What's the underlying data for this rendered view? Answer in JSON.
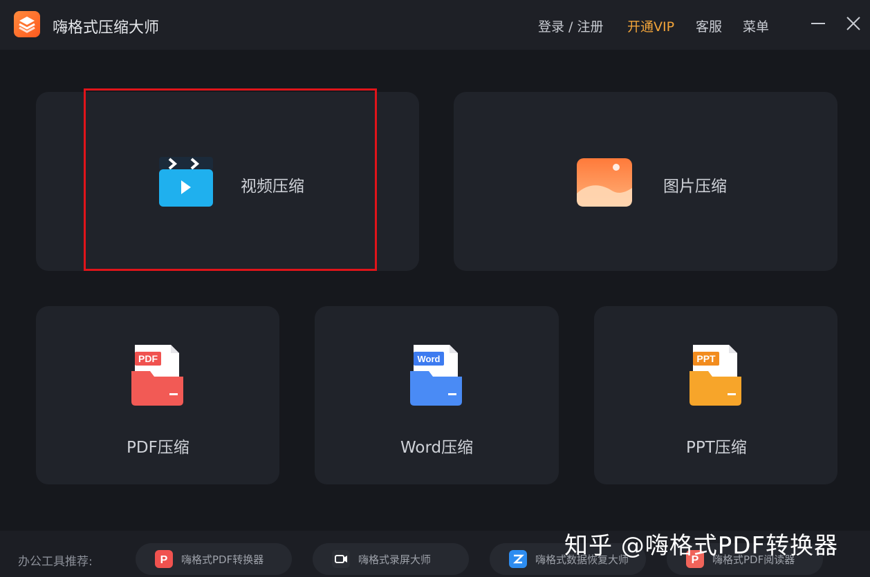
{
  "app": {
    "title": "嗨格式压缩大师"
  },
  "topnav": {
    "login": "登录 / 注册",
    "vip": "开通VIP",
    "service": "客服",
    "menu": "菜单"
  },
  "cards": {
    "video": "视频压缩",
    "image": "图片压缩",
    "pdf": "PDF压缩",
    "word": "Word压缩",
    "ppt": "PPT压缩"
  },
  "file_tags": {
    "pdf": "PDF",
    "word": "Word",
    "ppt": "PPT"
  },
  "footer": {
    "label": "办公工具推荐:",
    "items": [
      {
        "label": "嗨格式PDF转换器",
        "color": "#f0524f"
      },
      {
        "label": "嗨格式录屏大师",
        "color": "#2c2f36"
      },
      {
        "label": "嗨格式数据恢复大师",
        "color": "#2d8cf0"
      },
      {
        "label": "嗨格式PDF阅读器",
        "color": "#f0645a"
      }
    ]
  },
  "watermark": "知乎 @嗨格式PDF转换器",
  "colors": {
    "accent_vip": "#f3a53a",
    "highlight": "#e0141a"
  }
}
